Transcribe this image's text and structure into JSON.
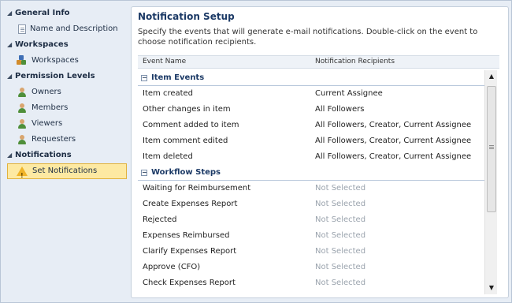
{
  "sidebar": {
    "groups": [
      {
        "label": "General Info",
        "items": [
          {
            "label": "Name and Description",
            "icon": "document-icon"
          }
        ]
      },
      {
        "label": "Workspaces",
        "items": [
          {
            "label": "Workspaces",
            "icon": "workspaces-icon"
          }
        ]
      },
      {
        "label": "Permission Levels",
        "items": [
          {
            "label": "Owners",
            "icon": "user-icon"
          },
          {
            "label": "Members",
            "icon": "user-icon"
          },
          {
            "label": "Viewers",
            "icon": "user-icon"
          },
          {
            "label": "Requesters",
            "icon": "user-icon"
          }
        ]
      },
      {
        "label": "Notifications",
        "items": [
          {
            "label": "Set Notifications",
            "icon": "warning-icon",
            "selected": true
          }
        ]
      }
    ]
  },
  "panel": {
    "title": "Notification Setup",
    "description": "Specify the events that will generate e-mail notifications. Double-click on the event to choose notification recipients.",
    "columns": {
      "event": "Event Name",
      "recipients": "Notification Recipients"
    }
  },
  "sections": [
    {
      "label": "Item Events",
      "rows": [
        {
          "event": "Item created",
          "recipients": "Current Assignee"
        },
        {
          "event": "Other changes in item",
          "recipients": "All Followers"
        },
        {
          "event": "Comment added to item",
          "recipients": "All Followers, Creator, Current Assignee"
        },
        {
          "event": "Item comment edited",
          "recipients": "All Followers, Creator, Current Assignee"
        },
        {
          "event": "Item deleted",
          "recipients": "All Followers, Creator, Current Assignee"
        }
      ]
    },
    {
      "label": "Workflow Steps",
      "rows": [
        {
          "event": "Waiting for Reimbursement",
          "recipients": "Not Selected"
        },
        {
          "event": "Create Expenses Report",
          "recipients": "Not Selected"
        },
        {
          "event": "Rejected",
          "recipients": "Not Selected"
        },
        {
          "event": "Expenses Reimbursed",
          "recipients": "Not Selected"
        },
        {
          "event": "Clarify Expenses Report",
          "recipients": "Not Selected"
        },
        {
          "event": "Approve (CFO)",
          "recipients": "Not Selected"
        },
        {
          "event": "Check Expenses Report",
          "recipients": "Not Selected"
        }
      ]
    }
  ],
  "colors": {
    "accent": "#1c3a66",
    "selected_bg": "#fde9a2",
    "muted": "#9aa3ad"
  }
}
